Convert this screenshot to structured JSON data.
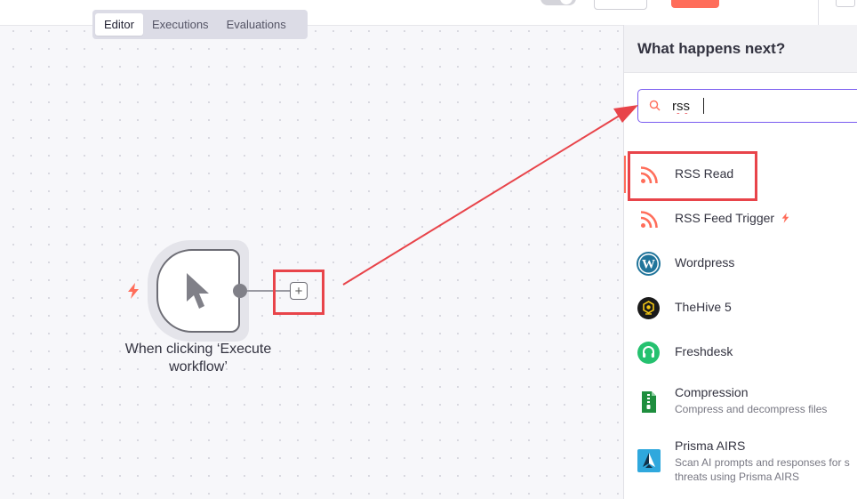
{
  "tabs": [
    {
      "label": "Editor",
      "active": true
    },
    {
      "label": "Executions",
      "active": false
    },
    {
      "label": "Evaluations",
      "active": false
    }
  ],
  "canvas": {
    "trigger_node": {
      "label_line1": "When clicking ‘Execute",
      "label_line2": "workflow’",
      "icon": "cursor-pointer-icon"
    },
    "add_node_button": "+"
  },
  "panel": {
    "title": "What happens next?",
    "search": {
      "value": "rss",
      "placeholder": ""
    },
    "results": [
      {
        "name": "RSS Read",
        "icon": "rss-icon",
        "selected": true
      },
      {
        "name": "RSS Feed Trigger",
        "icon": "rss-icon",
        "trigger": true
      },
      {
        "name": "Wordpress",
        "icon": "wordpress-icon"
      },
      {
        "name": "TheHive 5",
        "icon": "thehive-icon"
      },
      {
        "name": "Freshdesk",
        "icon": "freshdesk-icon"
      },
      {
        "name": "Compression",
        "description": "Compress and decompress files",
        "icon": "compression-icon"
      },
      {
        "name": "Prisma AIRS",
        "description": "Scan AI prompts and responses for s",
        "description2": "threats using Prisma AIRS",
        "icon": "prisma-airs-icon"
      }
    ]
  },
  "colors": {
    "accent": "#ff6d5a",
    "highlight": "#e8444a",
    "search_border": "#7a5cf0",
    "wordpress": "#21759b",
    "freshdesk": "#25c16f",
    "compression": "#1e8e3e",
    "prisma": "#2fa8dd"
  }
}
